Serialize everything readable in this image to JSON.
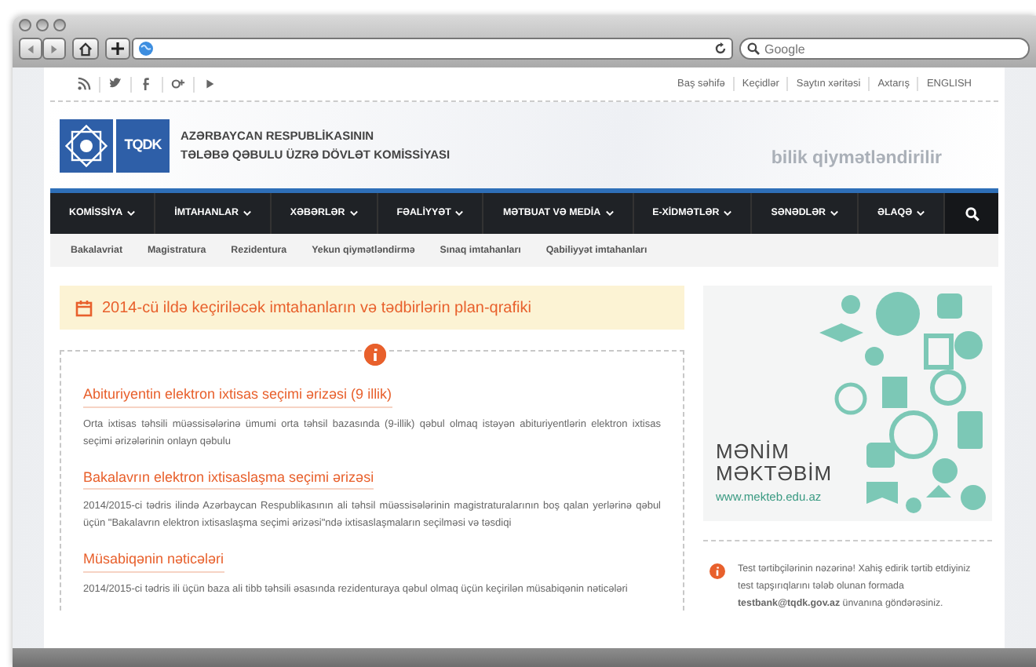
{
  "browser": {
    "search_placeholder": "Google"
  },
  "social": [
    {
      "kind": "rss"
    },
    {
      "kind": "twitter"
    },
    {
      "kind": "facebook"
    },
    {
      "kind": "gplus"
    },
    {
      "kind": "youtube"
    }
  ],
  "top_links": [
    "Baş səhifə",
    "Keçidlər",
    "Saytın xəritəsi",
    "Axtarış",
    "ENGLISH"
  ],
  "header": {
    "logo_text": "TQDK",
    "title_lines": [
      "AZƏRBAYCAN RESPUBLİKASININ",
      "TƏLƏBƏ QƏBULU ÜZRƏ DÖVLƏT KOMİSSİYASI"
    ],
    "slogan": "bilik qiymətləndirilir"
  },
  "nav": [
    "KOMİSSİYA",
    "İMTAHANLAR",
    "XƏBƏRLƏR",
    "FƏALİYYƏT",
    "MƏTBUAT VƏ MEDİA",
    "E-XİDMƏTLƏR",
    "SƏNƏDLƏR",
    "ƏLAQƏ"
  ],
  "subnav": [
    "Bakalavriat",
    "Magistratura",
    "Rezidentura",
    "Yekun qiymətləndirmə",
    "Sınaq imtahanları",
    "Qabiliyyət imtahanları"
  ],
  "banner": {
    "title": "2014-cü ildə keçiriləcək imtahanların və tədbirlərin plan-qrafiki"
  },
  "news": [
    {
      "title": "Abituriyentin elektron ixtisas seçimi ərizəsi (9 illik)",
      "text": "Orta ixtisas təhsili müəssisələrinə ümumi orta təhsil bazasında (9-illik) qəbul olmaq istəyən abituriyentlərin elektron ixtisas seçimi ərizələrinin onlayn qəbulu"
    },
    {
      "title": "Bakalavrın elektron ixtisaslaşma seçimi ərizəsi",
      "text": "2014/2015-ci tədris ilində Azərbaycan Respublikasının ali təhsil müəssisələrinin magistraturalarının boş qalan yerlərinə qəbul üçün \"Bakalavrın elektron ixtisaslaşma seçimi ərizəsi\"ndə ixtisaslaşmaların seçilməsi və təsdiqi"
    },
    {
      "title": "Müsabiqənin nəticələri",
      "text": "2014/2015-ci tədris ili üçün baza ali tibb təhsili əsasında rezidenturaya qəbul olmaq üçün keçirilən müsabiqənin nəticələri"
    }
  ],
  "ad": {
    "lines": [
      "MƏNİM",
      "MƏKTƏBİM"
    ],
    "url": "www.mekteb.edu.az"
  },
  "notice": {
    "text": "Test tərtibçilərinin nəzərinə! Xahiş edirik tərtib etdiyiniz test tapşırıqlarını tələb olunan formada **testbank@tqdk.gov.az** ünvanına göndərəsiniz."
  }
}
